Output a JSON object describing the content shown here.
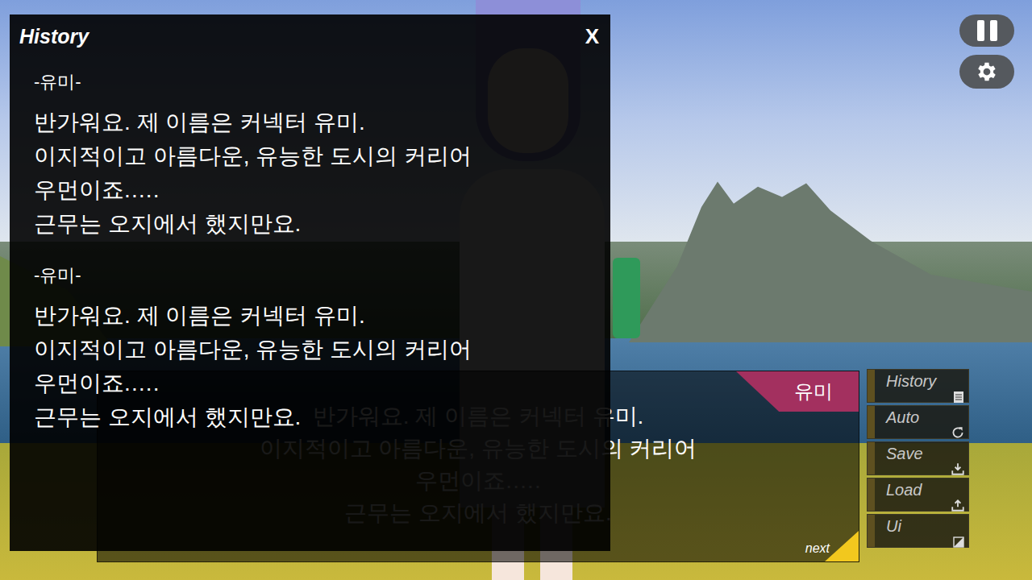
{
  "history": {
    "title": "History",
    "close": "X",
    "entries": [
      {
        "speaker": "-유미-",
        "lines": [
          "반가워요. 제 이름은 커넥터 유미.",
          "이지적이고 아름다운, 유능한 도시의 커리어",
          "우먼이죠.….",
          "근무는 오지에서 했지만요."
        ]
      },
      {
        "speaker": "-유미-",
        "lines": [
          "반가워요. 제 이름은 커넥터 유미.",
          "이지적이고 아름다운, 유능한 도시의 커리어",
          "우먼이죠.….",
          "근무는 오지에서 했지만요."
        ]
      }
    ]
  },
  "dialogue": {
    "speaker": "유미",
    "lines": [
      "반가워요. 제 이름은 커넥터 유미.",
      "이지적이고 아름다운, 유능한 도시의 커리어",
      "우먼이죠.….",
      "근무는 오지에서 했지만요."
    ],
    "next": "next"
  },
  "menu": [
    {
      "label": "History"
    },
    {
      "label": "Auto"
    },
    {
      "label": "Save"
    },
    {
      "label": "Load"
    },
    {
      "label": "Ui"
    }
  ]
}
